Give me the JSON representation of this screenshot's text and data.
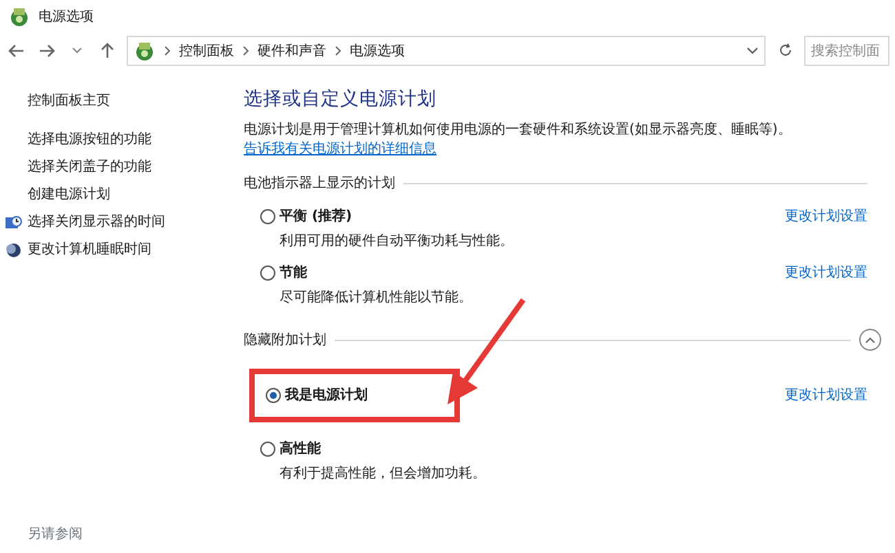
{
  "window": {
    "title": "电源选项"
  },
  "address_bar": {
    "breadcrumbs": [
      "控制面板",
      "硬件和声音",
      "电源选项"
    ]
  },
  "search": {
    "placeholder": "搜索控制面"
  },
  "sidebar": {
    "items": [
      {
        "label": "控制面板主页",
        "kind": "plain"
      },
      {
        "label": "选择电源按钮的功能",
        "kind": "plain"
      },
      {
        "label": "选择关闭盖子的功能",
        "kind": "plain"
      },
      {
        "label": "创建电源计划",
        "kind": "plain"
      },
      {
        "label": "选择关闭显示器的时间",
        "kind": "display"
      },
      {
        "label": "更改计算机睡眠时间",
        "kind": "sleep"
      }
    ],
    "see_also": "另请参阅"
  },
  "main": {
    "heading": "选择或自定义电源计划",
    "description": "电源计划是用于管理计算机如何使用电源的一套硬件和系统设置(如显示器亮度、睡眠等)。",
    "description_link": "告诉我有关电源计划的详细信息",
    "sections": [
      {
        "title": "电池指示器上显示的计划",
        "collapse_button": false,
        "plans": [
          {
            "name": "平衡 (推荐)",
            "description": "利用可用的硬件自动平衡功耗与性能。",
            "selected": false,
            "link": "更改计划设置",
            "highlighted": false
          },
          {
            "name": "节能",
            "description": "尽可能降低计算机性能以节能。",
            "selected": false,
            "link": "更改计划设置",
            "highlighted": false
          }
        ]
      },
      {
        "title": "隐藏附加计划",
        "collapse_button": true,
        "plans": [
          {
            "name": "我是电源计划",
            "selected": true,
            "link": "更改计划设置",
            "highlighted": true
          },
          {
            "name": "高性能",
            "description": "有利于提高性能，但会增加功耗。",
            "selected": false,
            "highlighted": false
          }
        ]
      }
    ]
  }
}
